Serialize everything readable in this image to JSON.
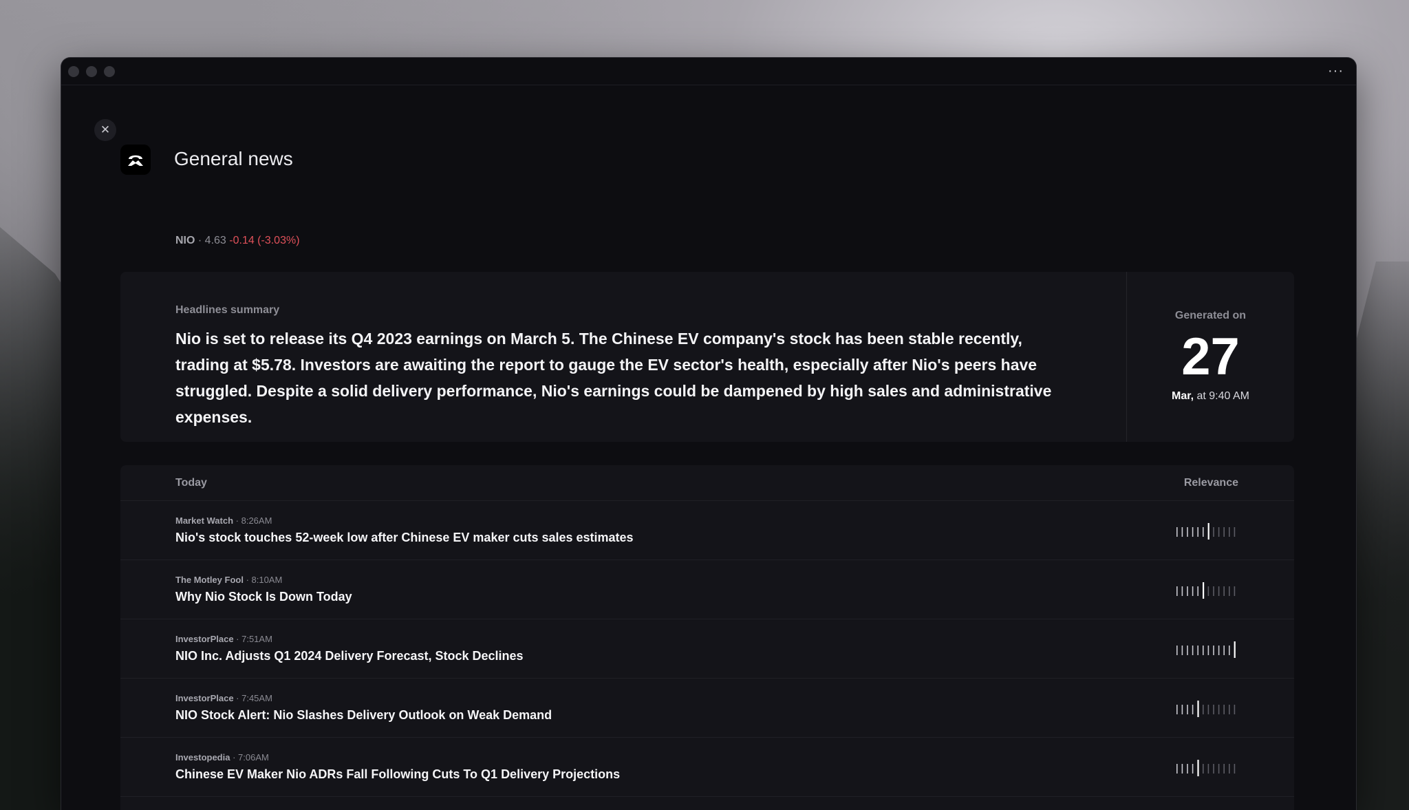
{
  "window": {
    "more_label": "···"
  },
  "page": {
    "close_label": "✕",
    "title": "General news"
  },
  "ticker": {
    "symbol": "NIO",
    "sep1": " · ",
    "price": "4.63",
    "change": "-0.14 (-3.03%)"
  },
  "summary": {
    "label": "Headlines summary",
    "text": "Nio is set to release its Q4 2023 earnings on March 5. The Chinese EV company's stock has been stable recently, trading at $5.78. Investors are awaiting the report to gauge the EV sector's health, especially after Nio's peers have struggled. Despite a solid delivery performance, Nio's earnings could be dampened by high sales and administrative expenses.",
    "generated_label": "Generated on",
    "generated_day": "27",
    "generated_month": "Mar,",
    "generated_time": " at 9:40 AM"
  },
  "news": {
    "section_label": "Today",
    "relevance_label": "Relevance",
    "items": [
      {
        "source": "Market Watch",
        "time": " · 8:26AM",
        "title": "Nio's stock touches 52-week low after Chinese EV maker cuts sales estimates",
        "relevance": 7
      },
      {
        "source": "The Motley Fool",
        "time": " · 8:10AM",
        "title": "Why Nio Stock Is Down Today",
        "relevance": 6
      },
      {
        "source": "InvestorPlace",
        "time": " · 7:51AM",
        "title": "NIO Inc. Adjusts Q1 2024 Delivery Forecast, Stock Declines",
        "relevance": 12
      },
      {
        "source": "InvestorPlace",
        "time": " · 7:45AM",
        "title": "NIO Stock Alert: Nio Slashes Delivery Outlook on Weak Demand",
        "relevance": 5
      },
      {
        "source": "Investopedia",
        "time": " · 7:06AM",
        "title": "Chinese EV Maker Nio ADRs Fall Following Cuts To Q1 Delivery Projections",
        "relevance": 5
      }
    ],
    "relevance_max": 12
  },
  "colors": {
    "negative": "#e0515a",
    "window_bg": "#0d0d11",
    "card_bg": "#141419"
  },
  "icons": [
    "close-icon",
    "nio-logo-icon",
    "more-icon"
  ]
}
